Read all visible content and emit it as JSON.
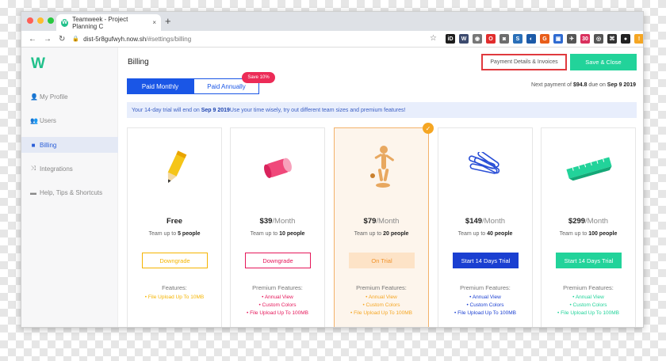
{
  "browser": {
    "tab_title": "Teamweek - Project Planning C",
    "tab_favicon": "W",
    "tab_close": "×",
    "new_tab": "+",
    "url_host": "dist-5r8gufwyh.now.sh",
    "url_path": "/#settings/billing",
    "nav_icons": [
      "arrow-left-icon",
      "arrow-right-icon",
      "reload-icon"
    ],
    "extensions": [
      {
        "label": "iD",
        "color": "#1d1d1d"
      },
      {
        "label": "W",
        "color": "#3c4a6e"
      },
      {
        "label": "◉",
        "color": "#777777"
      },
      {
        "label": "O",
        "color": "#e12d2d"
      },
      {
        "label": "◙",
        "color": "#6d6d6d"
      },
      {
        "label": "S",
        "color": "#2a6fb8"
      },
      {
        "label": "◐",
        "color": "#1c5aa8"
      },
      {
        "label": "G",
        "color": "#e85d1a"
      },
      {
        "label": "▣",
        "color": "#2f6bd1"
      },
      {
        "label": "✈",
        "color": "#555555"
      },
      {
        "label": "30",
        "color": "#d9305d"
      },
      {
        "label": "◎",
        "color": "#555555"
      },
      {
        "label": "⌘",
        "color": "#333333"
      },
      {
        "label": "●",
        "color": "#222222"
      },
      {
        "label": "!",
        "color": "#f5a623"
      }
    ]
  },
  "sidebar": {
    "logo": "W",
    "items": [
      {
        "label": "My Profile",
        "icon": "user-icon",
        "glyph": "👤"
      },
      {
        "label": "Users",
        "icon": "users-icon",
        "glyph": "👥"
      },
      {
        "label": "Billing",
        "icon": "folder-icon",
        "glyph": "■",
        "active": true
      },
      {
        "label": "Integrations",
        "icon": "shuffle-icon",
        "glyph": "⤨"
      },
      {
        "label": "Help, Tips & Shortcuts",
        "icon": "chat-icon",
        "glyph": "▬"
      }
    ]
  },
  "header": {
    "title": "Billing",
    "details_button": "Payment Details & Invoices",
    "save_button": "Save & Close"
  },
  "billing_toggle": {
    "monthly": "Paid Monthly",
    "annually": "Paid Annually",
    "badge": "Save 10%"
  },
  "next_payment": {
    "prefix": "Next payment of ",
    "amount": "$94.8",
    "middle": " due on ",
    "date": "Sep 9 2019"
  },
  "trial_banner": {
    "prefix": "Your 14-day trial will end on ",
    "date": "Sep 9 2019",
    "suffix": " Use your time wisely, try out different team sizes and premium features!"
  },
  "plans": [
    {
      "price": "Free",
      "period": "",
      "team_prefix": "Team up to ",
      "team_count": "5 people",
      "button": "Downgrade",
      "features_title": "Features:",
      "features": [
        "• File Upload Up To 10MB"
      ],
      "accent": "#f5b400",
      "illustration": "pencil"
    },
    {
      "price": "$39",
      "period": "/Month",
      "team_prefix": "Team up to ",
      "team_count": "10 people",
      "button": "Downgrade",
      "features_title": "Premium Features:",
      "features": [
        "• Annual View",
        "• Custom Colors",
        "• File Upload Up To 100MB"
      ],
      "accent": "#e5175a",
      "illustration": "eraser"
    },
    {
      "price": "$79",
      "period": "/Month",
      "team_prefix": "Team up to ",
      "team_count": "20 people",
      "button": "On Trial",
      "features_title": "Premium Features:",
      "features": [
        "• Annual View",
        "• Custom Colors",
        "• File Upload Up To 100MB"
      ],
      "accent": "#f5a623",
      "illustration": "mannequin"
    },
    {
      "price": "$149",
      "period": "/Month",
      "team_prefix": "Team up to ",
      "team_count": "40 people",
      "button": "Start 14 Days Trial",
      "features_title": "Premium Features:",
      "features": [
        "• Annual View",
        "• Custom Colors",
        "• File Upload Up To 100MB"
      ],
      "accent": "#1a3fd1",
      "illustration": "paperclips"
    },
    {
      "price": "$299",
      "period": "/Month",
      "team_prefix": "Team up to ",
      "team_count": "100 people",
      "button": "Start 14 Days Trial",
      "features_title": "Premium Features:",
      "features": [
        "• Annual View",
        "• Custom Colors",
        "• File Upload Up To 100MB"
      ],
      "accent": "#22d39a",
      "illustration": "ruler"
    }
  ]
}
